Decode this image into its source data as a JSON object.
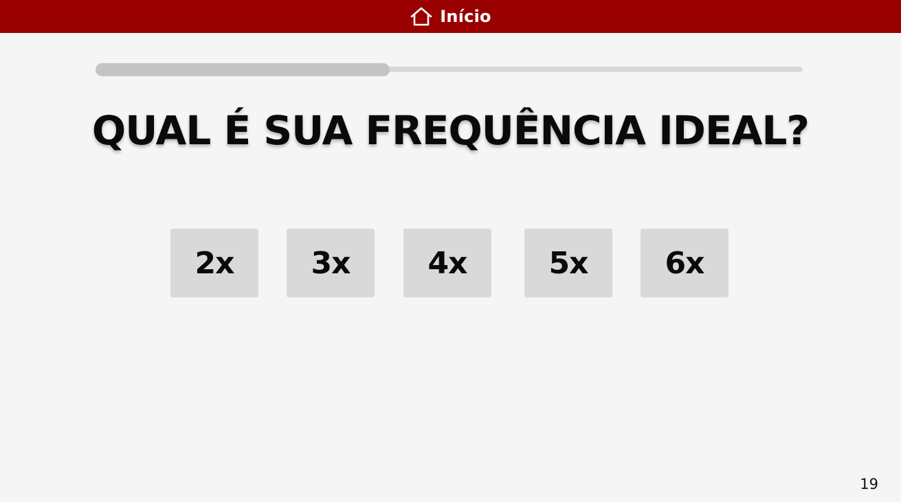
{
  "header": {
    "home_label": "Início",
    "icon": "home-icon"
  },
  "progress": {
    "value": 0.42
  },
  "question": {
    "title": "QUAL É SUA FREQUÊNCIA IDEAL?"
  },
  "options": [
    {
      "label": "2x"
    },
    {
      "label": "3x"
    },
    {
      "label": "4x"
    },
    {
      "label": "5x"
    },
    {
      "label": "6x"
    }
  ],
  "page": {
    "number": "19"
  },
  "colors": {
    "header_bg": "#9a0000",
    "page_bg": "#f5f5f5",
    "option_bg": "#d9d9d9",
    "progress_fill": "#c4c4c4",
    "progress_track": "#d8d8d8"
  }
}
